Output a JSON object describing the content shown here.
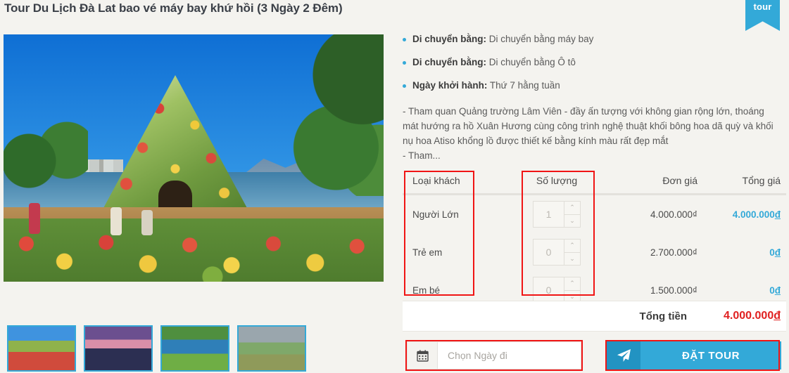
{
  "ribbon": {
    "label": "tour"
  },
  "page_title": "Tour Du Lịch Đà Lat bao vé máy bay khứ hồi (3 Ngày 2 Đêm)",
  "gallery": {
    "main_photo_alt": "Flower house at Da Lat flower garden",
    "thumbnails": [
      {
        "alt": "Flower house thumbnail"
      },
      {
        "alt": "Lake at sunset thumbnail"
      },
      {
        "alt": "Golf course lake thumbnail"
      },
      {
        "alt": "Mountain valley thumbnail"
      }
    ]
  },
  "facts": [
    {
      "label": "Di chuyển bằng:",
      "value": "Di chuyển bằng máy bay"
    },
    {
      "label": "Di chuyển bằng:",
      "value": "Di chuyển bằng Ô tô"
    },
    {
      "label": "Ngày khởi hành:",
      "value": "Thứ 7 hằng tuần"
    }
  ],
  "description": "- Tham quan Quảng trường Lâm Viên - đầy ấn tượng với không gian rộng lớn, thoáng mát hướng ra hồ Xuân Hương cùng công trình nghệ thuật khối bông hoa dã quỳ và khối nụ hoa Atiso khổng lồ được thiết kế bằng kính màu rất đẹp mắt",
  "description_more": "- Tham...",
  "pricing": {
    "headers": {
      "type": "Loại khách",
      "quantity": "Số lượng",
      "unit_price": "Đơn giá",
      "total_price": "Tổng giá"
    },
    "rows": [
      {
        "type": "Người Lớn",
        "qty": "1",
        "unit_price": "4.000.000₫",
        "unit_price_num": "4.000.000",
        "total": "4.000.000",
        "currency": "đ"
      },
      {
        "type": "Trẻ em",
        "qty": "0",
        "unit_price": "2.700.000₫",
        "unit_price_num": "2.700.000",
        "total": "0",
        "currency": "đ"
      },
      {
        "type": "Em bé",
        "qty": "0",
        "unit_price": "1.500.000₫",
        "unit_price_num": "1.500.000",
        "total": "0",
        "currency": "đ"
      }
    ],
    "spinner_up": "⌃",
    "spinner_down": "⌄"
  },
  "total": {
    "label": "Tổng tiền",
    "value": "4.000.000",
    "currency": "đ"
  },
  "date_picker": {
    "icon": "calendar-icon",
    "placeholder": "Chọn Ngày đi",
    "value": ""
  },
  "book_button": {
    "label": "ĐẶT TOUR",
    "icon": "paper-plane-icon"
  },
  "colors": {
    "accent_cyan": "#33a9d8",
    "accent_cyan_dark": "#2293c2",
    "total_red": "#e02020",
    "annotation_red": "#f01414",
    "page_bg": "#f4f3ef"
  }
}
